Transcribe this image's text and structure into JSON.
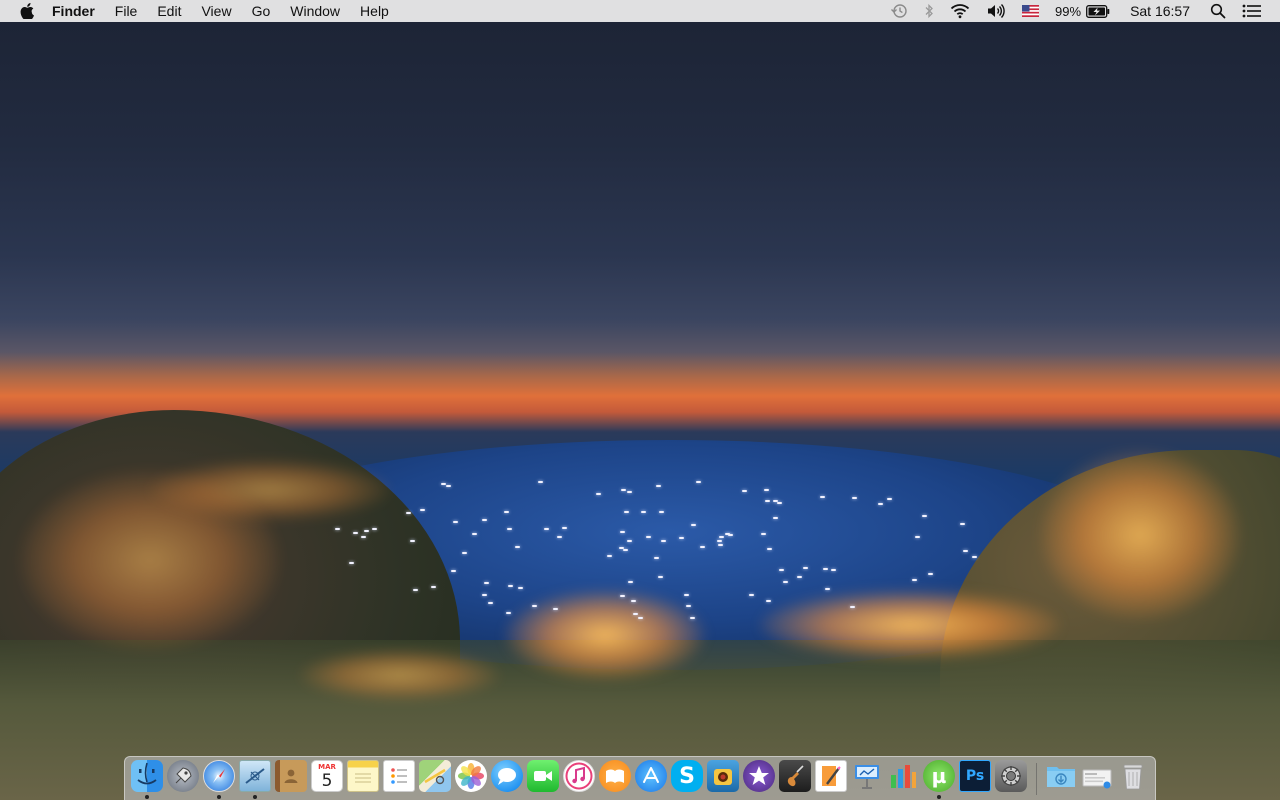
{
  "menubar": {
    "app_name": "Finder",
    "menus": [
      "File",
      "Edit",
      "View",
      "Go",
      "Window",
      "Help"
    ],
    "status": {
      "battery_percent": "99%",
      "clock": "Sat 16:57",
      "icons": [
        "time-machine-icon",
        "bluetooth-icon",
        "wifi-icon",
        "volume-icon",
        "us-flag-input-icon",
        "battery-charging-icon",
        "spotlight-search-icon",
        "notification-center-icon"
      ]
    }
  },
  "dock": {
    "calendar_month": "MAR",
    "calendar_day": "5",
    "apps": [
      {
        "name": "finder",
        "running": true
      },
      {
        "name": "launchpad",
        "running": false
      },
      {
        "name": "safari",
        "running": true
      },
      {
        "name": "mail",
        "running": true
      },
      {
        "name": "contacts",
        "running": false
      },
      {
        "name": "calendar",
        "running": false
      },
      {
        "name": "notes",
        "running": false
      },
      {
        "name": "reminders",
        "running": false
      },
      {
        "name": "maps",
        "running": false
      },
      {
        "name": "photos",
        "running": false
      },
      {
        "name": "messages",
        "running": false
      },
      {
        "name": "facetime",
        "running": false
      },
      {
        "name": "itunes",
        "running": false
      },
      {
        "name": "ibooks",
        "running": false
      },
      {
        "name": "app-store",
        "running": false
      },
      {
        "name": "skype",
        "running": false
      },
      {
        "name": "photo-booth",
        "running": false
      },
      {
        "name": "imovie",
        "running": false
      },
      {
        "name": "garageband",
        "running": false
      },
      {
        "name": "pages",
        "running": false
      },
      {
        "name": "keynote",
        "running": false
      },
      {
        "name": "numbers",
        "running": false
      },
      {
        "name": "utorrent",
        "running": true
      },
      {
        "name": "photoshop",
        "running": false
      },
      {
        "name": "system-preferences",
        "running": false
      },
      {
        "name": "downloads-folder",
        "running": false
      },
      {
        "name": "documents-stack",
        "running": false
      },
      {
        "name": "trash",
        "running": false
      }
    ]
  },
  "colors": {
    "menubar_bg": "#e8e8e8",
    "dock_bg": "rgba(200,200,205,0.55)"
  }
}
